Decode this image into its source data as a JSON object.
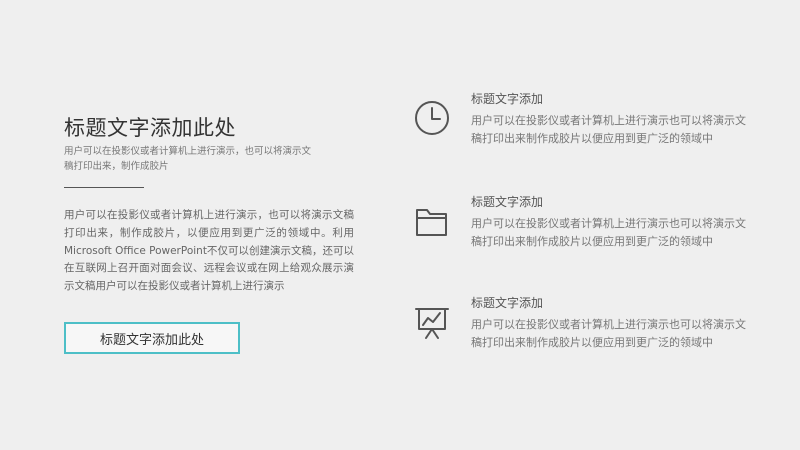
{
  "main": {
    "title": "标题文字添加此处",
    "subtitle": "用户可以在投影仪或者计算机上进行演示，也可以将演示文稿打印出来，制作成胶片",
    "body": "用户可以在投影仪或者计算机上进行演示，也可以将演示文稿打印出来，制作成胶片，以便应用到更广泛的领域中。利用Microsoft Office PowerPoint不仅可以创建演示文稿，还可以在互联网上召开面对面会议、远程会议或在网上给观众展示演示文稿用户可以在投影仪或者计算机上进行演示",
    "button_label": "标题文字添加此处"
  },
  "features": [
    {
      "icon": "clock-icon",
      "title": "标题文字添加",
      "body": "用户可以在投影仪或者计算机上进行演示也可以将演示文稿打印出来制作成胶片以便应用到更广泛的领域中"
    },
    {
      "icon": "folder-icon",
      "title": "标题文字添加",
      "body": "用户可以在投影仪或者计算机上进行演示也可以将演示文稿打印出来制作成胶片以便应用到更广泛的领域中"
    },
    {
      "icon": "presentation-chart-icon",
      "title": "标题文字添加",
      "body": "用户可以在投影仪或者计算机上进行演示也可以将演示文稿打印出来制作成胶片以便应用到更广泛的领域中"
    }
  ],
  "colors": {
    "background": "#efefef",
    "accent": "#4dbfc7",
    "heading": "#333333",
    "text": "#777777"
  }
}
